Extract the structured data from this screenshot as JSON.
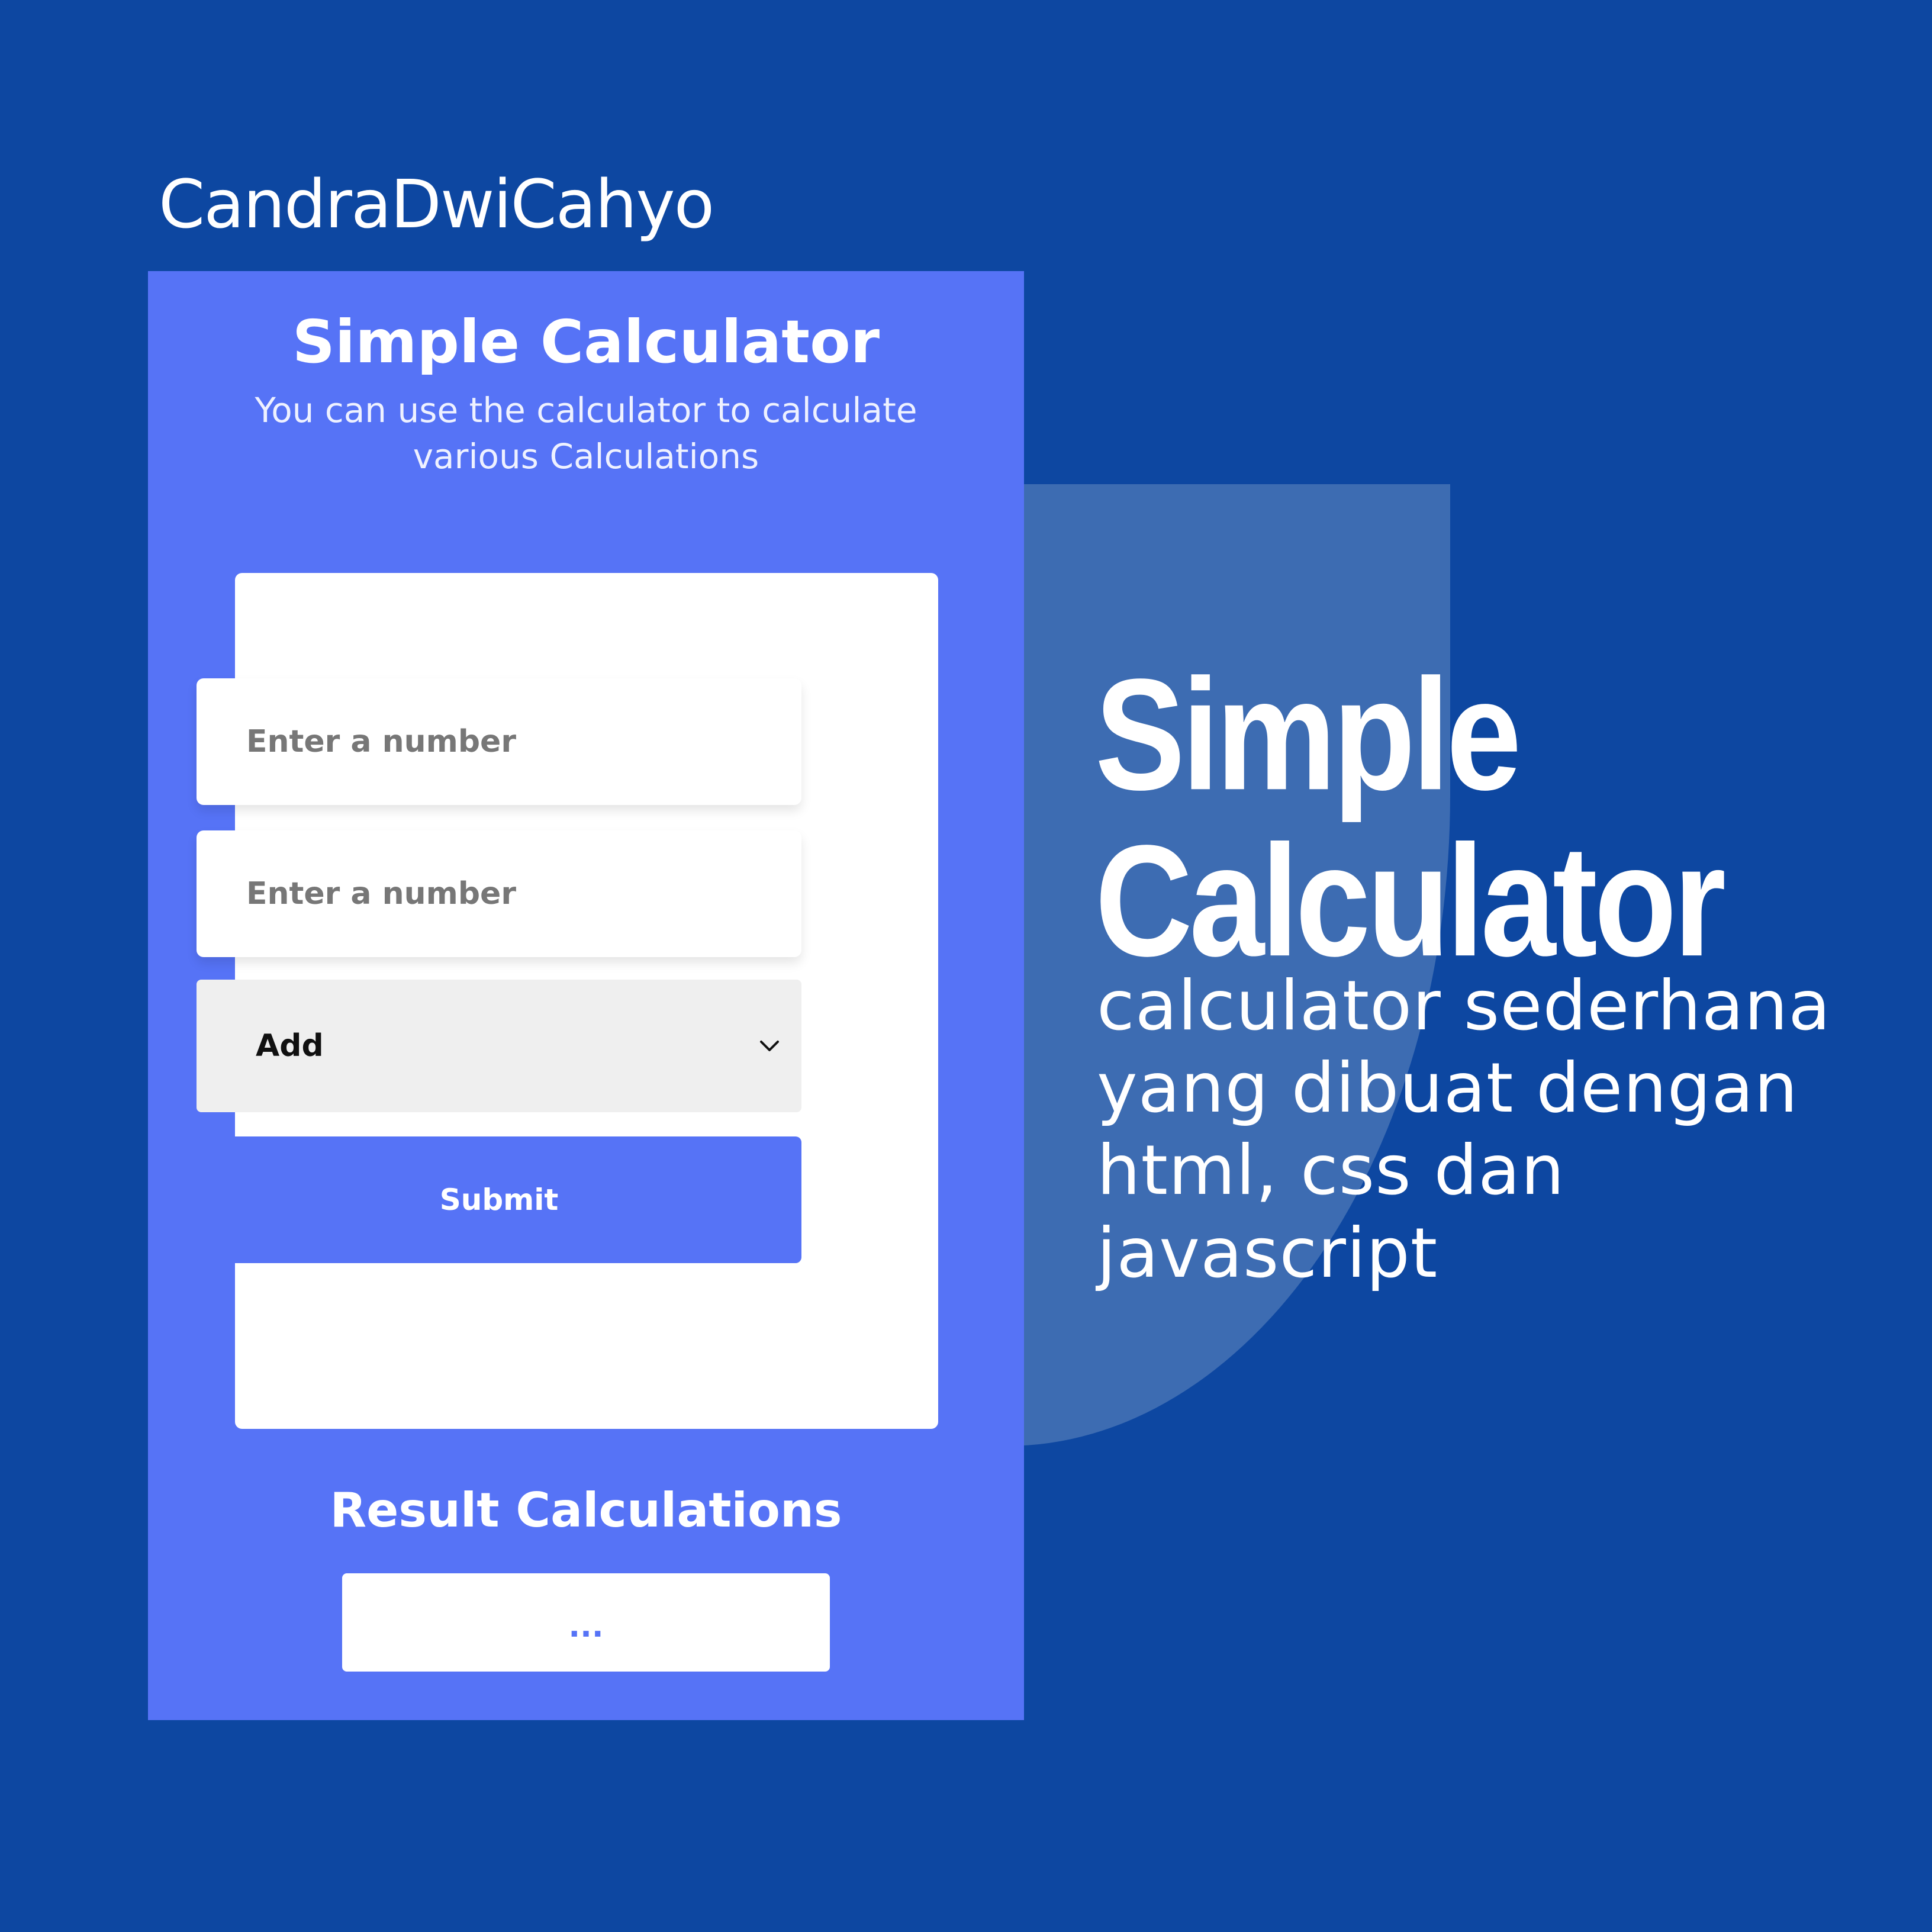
{
  "brand": {
    "name": "CandraDwiCahyo"
  },
  "app": {
    "title": "Simple Calculator",
    "subtitle": "You can use the calculator to calculate various Calculations"
  },
  "form": {
    "input1": {
      "placeholder": "Enter a number",
      "value": ""
    },
    "input2": {
      "placeholder": "Enter a number",
      "value": ""
    },
    "operation": {
      "selected": "Add",
      "icon": "chevron-down-icon"
    },
    "submit_label": "Submit"
  },
  "result": {
    "title": "Result Calculations",
    "value": "..."
  },
  "promo": {
    "title": "Simple Calculator",
    "description": "calculator sederhana yang dibuat dengan html, css dan javascript"
  },
  "colors": {
    "background": "#0d47a1",
    "panel": "#5673f6",
    "decor": "#3d6cb2",
    "card": "#ffffff",
    "select_bg": "#efefef"
  }
}
